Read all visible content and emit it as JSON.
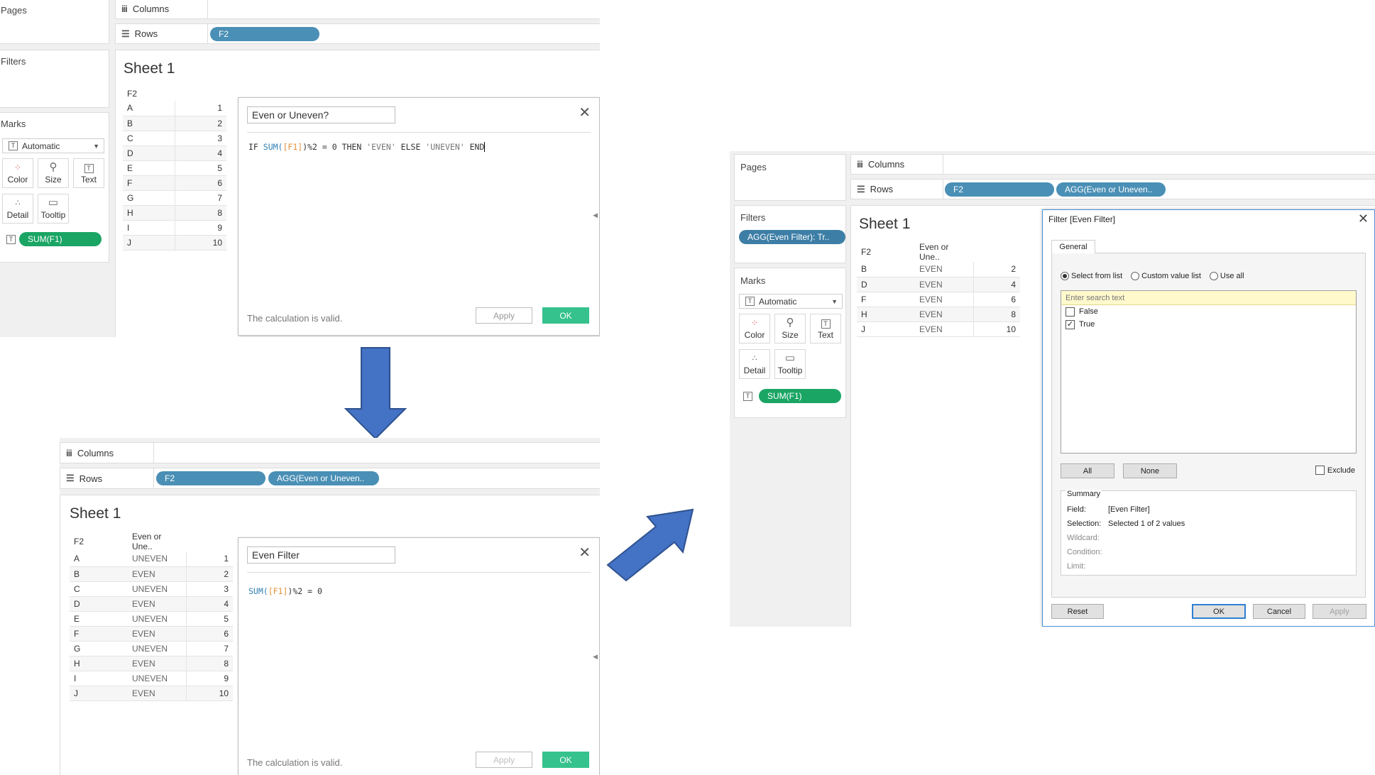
{
  "shelves": {
    "pages": "Pages",
    "filters": "Filters",
    "marks": "Marks",
    "columns": "Columns",
    "rows": "Rows"
  },
  "marks": {
    "type": "Automatic",
    "color": "Color",
    "size": "Size",
    "text": "Text",
    "detail": "Detail",
    "tooltip": "Tooltip"
  },
  "pills": {
    "f2": "F2",
    "agg_even": "AGG(Even or Uneven..",
    "sum_f1": "SUM(F1)",
    "agg_filter": "AGG(Even Filter): Tr.."
  },
  "sheet_title": "Sheet 1",
  "table_headers": {
    "f2": "F2",
    "even_or_uneven": "Even or Une.."
  },
  "panel1": {
    "rows": [
      {
        "k": "A",
        "v": "1"
      },
      {
        "k": "B",
        "v": "2"
      },
      {
        "k": "C",
        "v": "3"
      },
      {
        "k": "D",
        "v": "4"
      },
      {
        "k": "E",
        "v": "5"
      },
      {
        "k": "F",
        "v": "6"
      },
      {
        "k": "G",
        "v": "7"
      },
      {
        "k": "H",
        "v": "8"
      },
      {
        "k": "I",
        "v": "9"
      },
      {
        "k": "J",
        "v": "10"
      }
    ],
    "calc": {
      "name": "Even or Uneven?",
      "code": {
        "if": "IF ",
        "sum": "SUM(",
        "field": "[F1]",
        "rest": ")%2 = 0 THEN ",
        "even": "'EVEN'",
        "else": " ELSE ",
        "uneven": "'UNEVEN'",
        "end": " END"
      },
      "valid": "The calculation is valid.",
      "apply": "Apply",
      "ok": "OK"
    }
  },
  "panel2": {
    "rows": [
      {
        "k": "A",
        "c": "UNEVEN",
        "v": "1"
      },
      {
        "k": "B",
        "c": "EVEN",
        "v": "2"
      },
      {
        "k": "C",
        "c": "UNEVEN",
        "v": "3"
      },
      {
        "k": "D",
        "c": "EVEN",
        "v": "4"
      },
      {
        "k": "E",
        "c": "UNEVEN",
        "v": "5"
      },
      {
        "k": "F",
        "c": "EVEN",
        "v": "6"
      },
      {
        "k": "G",
        "c": "UNEVEN",
        "v": "7"
      },
      {
        "k": "H",
        "c": "EVEN",
        "v": "8"
      },
      {
        "k": "I",
        "c": "UNEVEN",
        "v": "9"
      },
      {
        "k": "J",
        "c": "EVEN",
        "v": "10"
      }
    ],
    "calc": {
      "name": "Even Filter",
      "code": {
        "sum": "SUM(",
        "field": "[F1]",
        "rest": ")%2 = 0"
      },
      "valid": "The calculation is valid.",
      "apply": "Apply",
      "ok": "OK"
    }
  },
  "panel3": {
    "rows": [
      {
        "k": "B",
        "c": "EVEN",
        "v": "2"
      },
      {
        "k": "D",
        "c": "EVEN",
        "v": "4"
      },
      {
        "k": "F",
        "c": "EVEN",
        "v": "6"
      },
      {
        "k": "H",
        "c": "EVEN",
        "v": "8"
      },
      {
        "k": "J",
        "c": "EVEN",
        "v": "10"
      }
    ]
  },
  "filter_dialog": {
    "title": "Filter [Even Filter]",
    "tab": "General",
    "radio_select": "Select from list",
    "radio_custom": "Custom value list",
    "radio_all": "Use all",
    "search_placeholder": "Enter search text",
    "items": [
      {
        "label": "False",
        "checked": false
      },
      {
        "label": "True",
        "checked": true
      }
    ],
    "all_btn": "All",
    "none_btn": "None",
    "exclude": "Exclude",
    "summary_title": "Summary",
    "field_label": "Field:",
    "field_value": "[Even Filter]",
    "selection_label": "Selection:",
    "selection_value": "Selected 1 of 2 values",
    "wildcard_label": "Wildcard:",
    "condition_label": "Condition:",
    "limit_label": "Limit:",
    "reset": "Reset",
    "ok": "OK",
    "cancel": "Cancel",
    "apply": "Apply"
  },
  "colors": {
    "pill_blue": "#4a8fb5",
    "pill_green": "#1aa564",
    "ok_green": "#35c28d",
    "arrow_blue": "#4472c4"
  }
}
